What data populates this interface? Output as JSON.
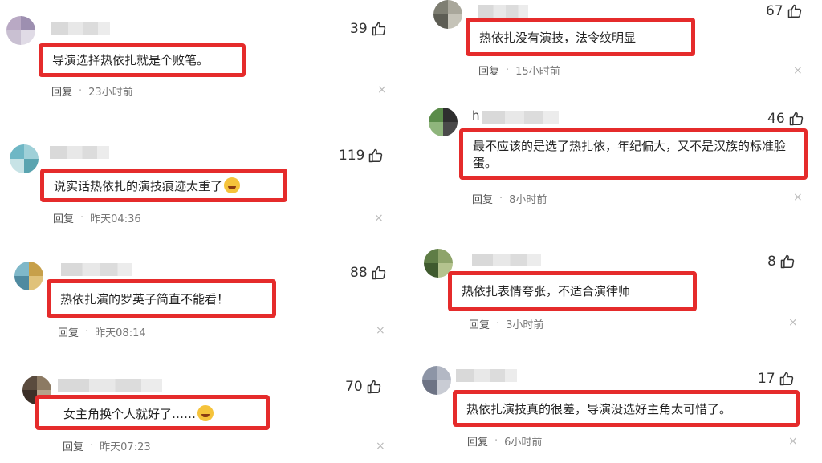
{
  "comments": [
    {
      "likes": "39",
      "text": "导演选择热依扎就是个败笔。",
      "reply": "回复",
      "time": "23小时前",
      "close": "×",
      "emoji": false,
      "avatar_colors": [
        "#b9a9c4",
        "#9d8fb0",
        "#c9c0d2",
        "#e0dbe6"
      ]
    },
    {
      "likes": "119",
      "text": "说实话热依扎的演技痕迹太重了",
      "reply": "回复",
      "time": "昨天04:36",
      "close": "×",
      "emoji": true,
      "avatar_colors": [
        "#6fb7c5",
        "#9fd0d8",
        "#c7e3e6",
        "#5aa4b0"
      ]
    },
    {
      "likes": "88",
      "text": "热依扎演的罗英子简直不能看！",
      "reply": "回复",
      "time": "昨天08:14",
      "close": "×",
      "emoji": false,
      "avatar_colors": [
        "#7fb8c9",
        "#c7a04a",
        "#4f8aa0",
        "#e0c27a"
      ]
    },
    {
      "likes": "70",
      "text": "女主角换个人就好了……",
      "reply": "回复",
      "time": "昨天07:23",
      "close": "×",
      "emoji": true,
      "avatar_colors": [
        "#5a4b3e",
        "#8c7a63",
        "#3b2f27",
        "#b5a28a"
      ]
    },
    {
      "likes": "67",
      "text": "热依扎没有演技，法令纹明显",
      "reply": "回复",
      "time": "15小时前",
      "close": "×",
      "emoji": false,
      "avatar_colors": [
        "#7e7e72",
        "#a9a79b",
        "#5d5d54",
        "#c5c3b8"
      ]
    },
    {
      "likes": "46",
      "initial": "h",
      "text": "最不应该的是选了热扎依，年纪偏大，又不是汉族的标准脸蛋。",
      "reply": "回复",
      "time": "8小时前",
      "close": "×",
      "emoji": false,
      "avatar_colors": [
        "#5b8c4a",
        "#2f2f2f",
        "#8fb57c",
        "#4a4a4a"
      ]
    },
    {
      "likes": "8",
      "text": "热依扎表情夸张，不适合演律师",
      "reply": "回复",
      "time": "3小时前",
      "close": "×",
      "emoji": false,
      "avatar_colors": [
        "#5f7d46",
        "#8ea46a",
        "#3f5a2e",
        "#b4c38e"
      ]
    },
    {
      "likes": "17",
      "text": "热依扎演技真的很差，导演没选好主角太可惜了。",
      "reply": "回复",
      "time": "6小时前",
      "close": "×",
      "emoji": false,
      "avatar_colors": [
        "#8d95a6",
        "#b3b8c4",
        "#6d7384",
        "#c9ccd4"
      ]
    }
  ]
}
